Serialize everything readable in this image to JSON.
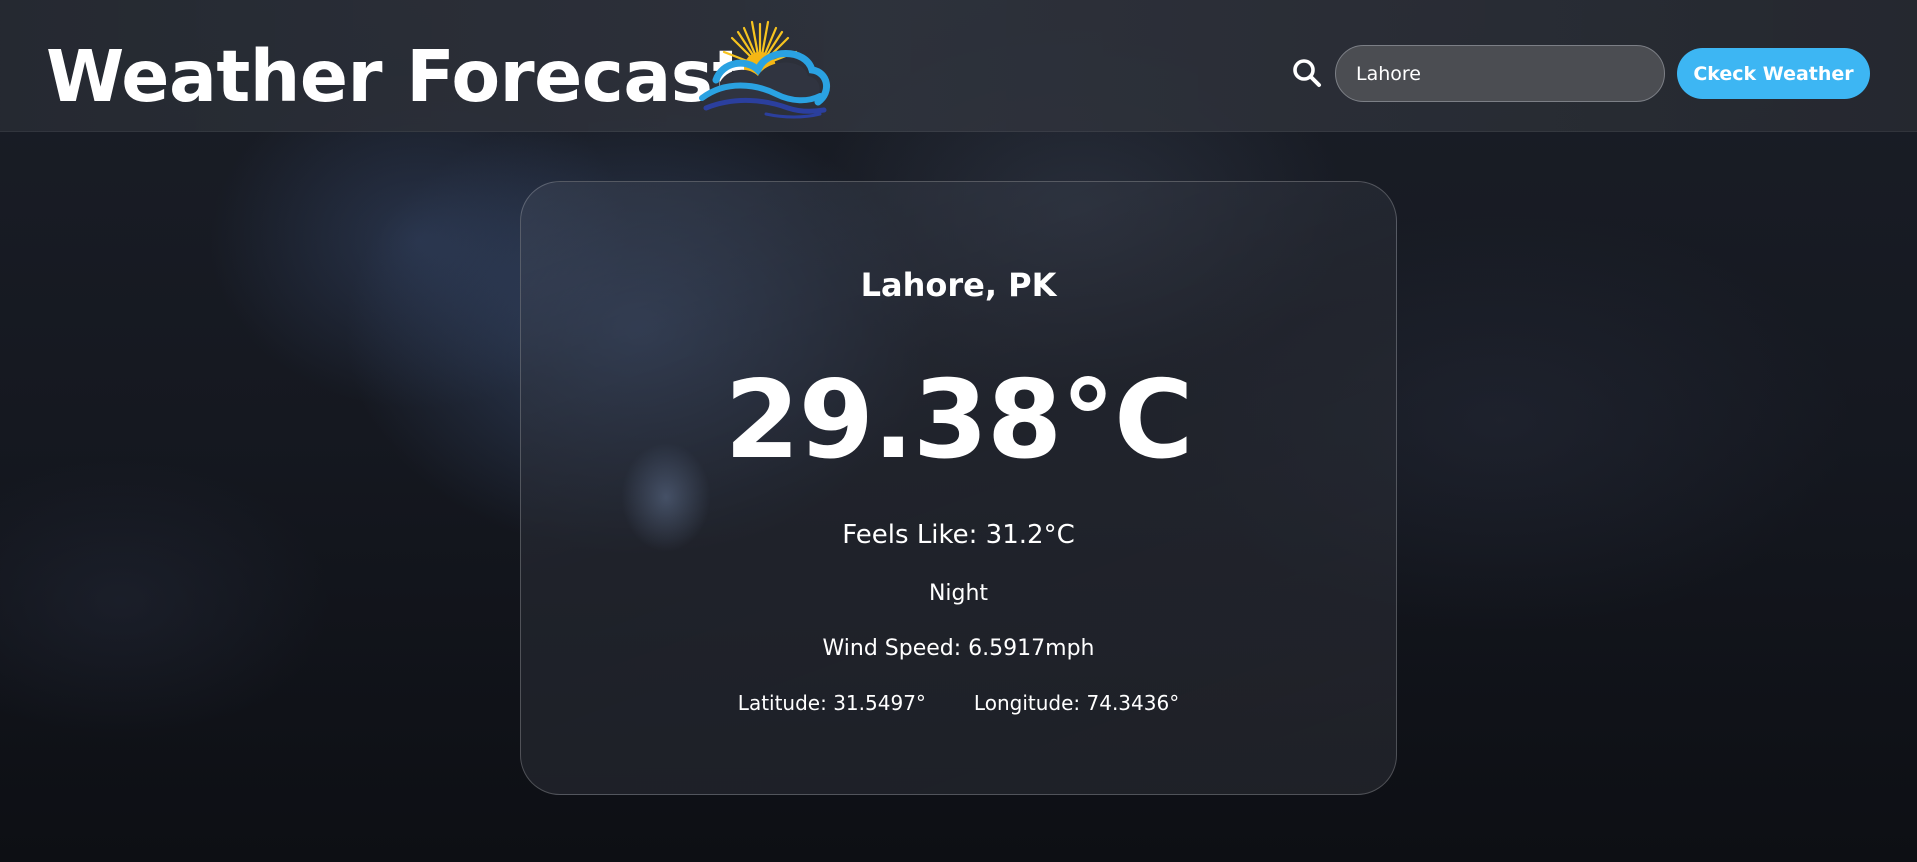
{
  "header": {
    "title": "Weather Forecast",
    "logo_icon": "sun-cloud-logo-icon",
    "search": {
      "icon": "search-icon",
      "value": "Lahore",
      "placeholder": ""
    },
    "check_button_label": "Ckeck Weather"
  },
  "weather": {
    "location": "Lahore, PK",
    "temperature": "29.38°C",
    "feels_like": "Feels Like: 31.2°C",
    "condition": "Night",
    "wind_speed": "Wind Speed: 6.5917mph",
    "latitude": "Latitude: 31.5497°",
    "longitude": "Longitude: 74.3436°"
  },
  "colors": {
    "accent": "#3db6f3",
    "input_bg": "#4b4d52",
    "sun": "#f7c41f",
    "cloud": "#2aa2e2",
    "wave": "#2b3f9e"
  }
}
